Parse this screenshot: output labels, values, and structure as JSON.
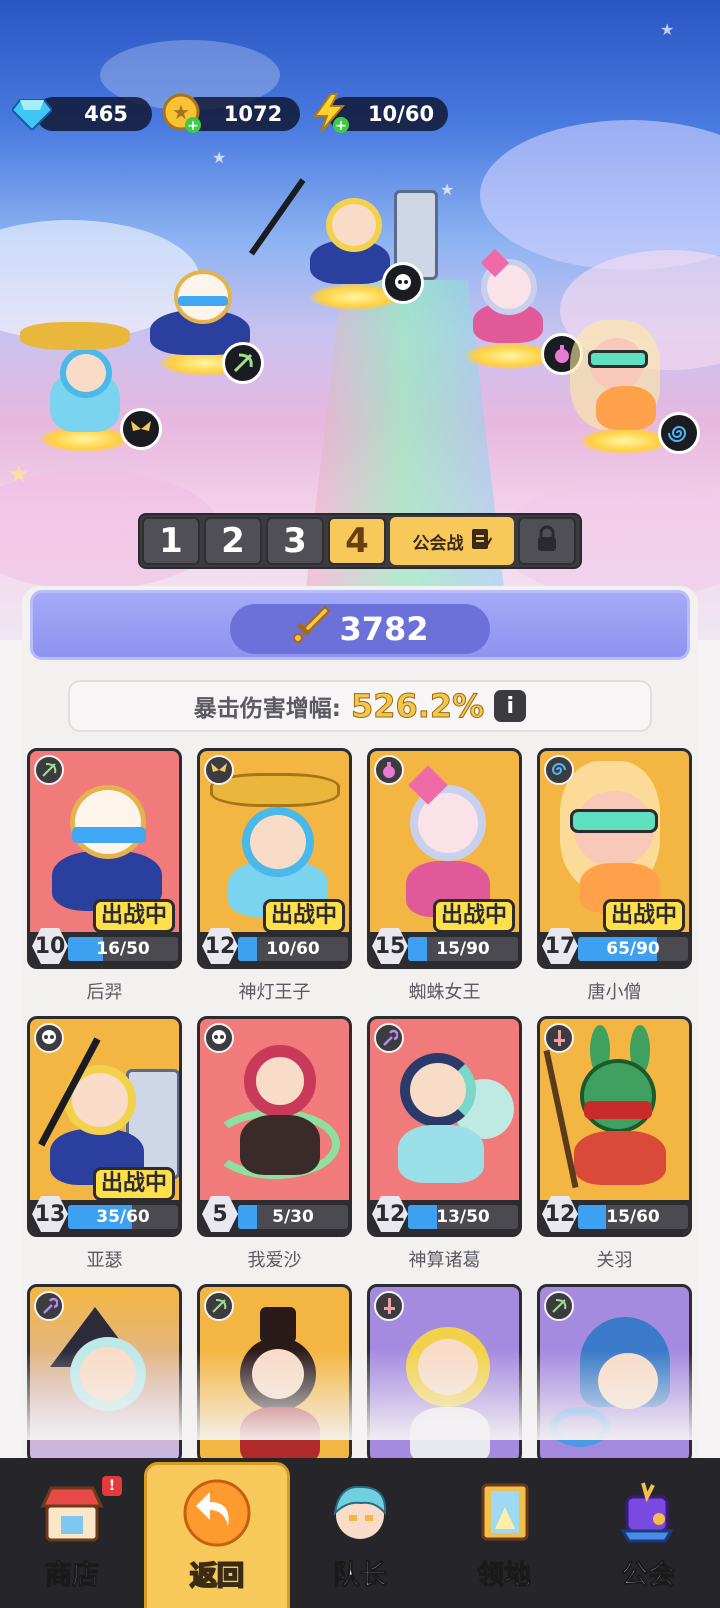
{
  "resources": {
    "diamonds": "465",
    "gold": "1072",
    "energy": "10/60"
  },
  "team_tabs": [
    "1",
    "2",
    "3",
    "4"
  ],
  "active_tab": "4",
  "guild_tab_label": "公会战",
  "power": "3782",
  "crit": {
    "label": "暴击伤害增幅:",
    "value": "526.2%",
    "info_icon": "i"
  },
  "heroes": [
    {
      "name": "后羿",
      "level": "10",
      "progress": "16/50",
      "progress_fraction": 0.32,
      "in_battle": true,
      "class_icon": "bow-icon",
      "color": "red"
    },
    {
      "name": "神灯王子",
      "level": "12",
      "progress": "10/60",
      "progress_fraction": 0.17,
      "in_battle": true,
      "class_icon": "wings-icon",
      "color": "yellow"
    },
    {
      "name": "蜘蛛女王",
      "level": "15",
      "progress": "15/90",
      "progress_fraction": 0.17,
      "in_battle": true,
      "class_icon": "potion-icon",
      "color": "yellow"
    },
    {
      "name": "唐小僧",
      "level": "17",
      "progress": "65/90",
      "progress_fraction": 0.72,
      "in_battle": true,
      "class_icon": "spiral-icon",
      "color": "yellow"
    },
    {
      "name": "亚瑟",
      "level": "13",
      "progress": "35/60",
      "progress_fraction": 0.58,
      "in_battle": true,
      "class_icon": "skull-icon",
      "color": "yellow"
    },
    {
      "name": "我爱沙",
      "level": "5",
      "progress": "5/30",
      "progress_fraction": 0.17,
      "in_battle": false,
      "class_icon": "skull-icon",
      "color": "red"
    },
    {
      "name": "神算诸葛",
      "level": "12",
      "progress": "13/50",
      "progress_fraction": 0.26,
      "in_battle": false,
      "class_icon": "wand-icon",
      "color": "red"
    },
    {
      "name": "关羽",
      "level": "12",
      "progress": "15/60",
      "progress_fraction": 0.25,
      "in_battle": false,
      "class_icon": "sword-icon",
      "color": "yellow"
    }
  ],
  "in_battle_label": "出战中",
  "partial_heroes": [
    {
      "class_icon": "wand-icon",
      "color": "yellow"
    },
    {
      "class_icon": "bow-icon",
      "color": "yellow"
    },
    {
      "class_icon": "sword-icon",
      "color": "purple"
    },
    {
      "class_icon": "bow-icon",
      "color": "purple"
    }
  ],
  "nav": [
    {
      "label": "商店",
      "icon": "shop-icon",
      "badge": "!"
    },
    {
      "label": "返回",
      "icon": "back-arrow-icon"
    },
    {
      "label": "队长",
      "icon": "captain-icon"
    },
    {
      "label": "领地",
      "icon": "territory-icon"
    },
    {
      "label": "公会",
      "icon": "guild-icon"
    }
  ],
  "colors": {
    "red_card": "#f07b7a",
    "yellow_card": "#f4b642",
    "purple_card": "#a58be0",
    "accent": "#f7c85a"
  }
}
